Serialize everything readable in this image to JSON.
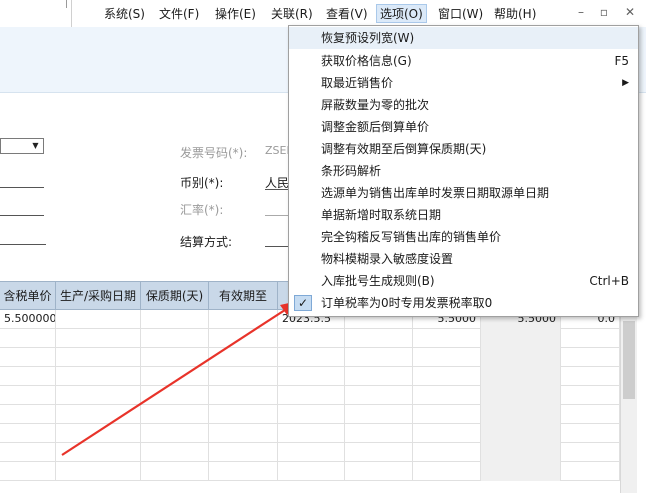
{
  "menubar": {
    "items": [
      {
        "label": "系统(S)"
      },
      {
        "label": "文件(F)"
      },
      {
        "label": "操作(E)"
      },
      {
        "label": "关联(R)"
      },
      {
        "label": "查看(V)"
      },
      {
        "label": "选项(O)"
      },
      {
        "label": "窗口(W)"
      },
      {
        "label": "帮助(H)"
      }
    ],
    "active_index": 5,
    "window_buttons": {
      "minimize": "–",
      "restore": "▫",
      "close": "✕"
    }
  },
  "form": {
    "invoice_no_label": "发票号码(*):",
    "invoice_no_value": "ZSEF",
    "currency_label": "币别(*):",
    "currency_value": "人民",
    "rate_label": "汇率(*):",
    "settlement_label": "结算方式:"
  },
  "grid": {
    "columns": [
      "含税单价",
      "生产/采购日期",
      "保质期(天)",
      "有效期至"
    ],
    "first_row": {
      "unit_price": "5.500000",
      "date": "2023.5.5",
      "v1": "5.5000",
      "v2": "5.5000",
      "v3": "0.0"
    }
  },
  "dropdown": {
    "items": [
      {
        "label": "恢复预设列宽(W)"
      },
      {
        "label": "获取价格信息(G)",
        "shortcut": "F5"
      },
      {
        "label": "取最近销售价",
        "submenu": true
      },
      {
        "label": "屏蔽数量为零的批次"
      },
      {
        "label": "调整金额后倒算单价"
      },
      {
        "label": "调整有效期至后倒算保质期(天)"
      },
      {
        "label": "条形码解析"
      },
      {
        "label": "选源单为销售出库单时发票日期取源单日期"
      },
      {
        "label": "单据新增时取系统日期"
      },
      {
        "label": "完全钩稽反写销售出库的销售单价"
      },
      {
        "label": "物料模糊录入敏感度设置"
      },
      {
        "label": "入库批号生成规则(B)",
        "shortcut": "Ctrl+B"
      },
      {
        "label": "订单税率为0时专用发票税率取0",
        "checked": true
      }
    ],
    "check_mark": "✓",
    "submenu_arrow": "▶"
  },
  "colors": {
    "menu_active": "#dbe9f8",
    "band": "#eef5fc",
    "grid_header": "#c9d8e8",
    "arrow": "#e8332a"
  }
}
